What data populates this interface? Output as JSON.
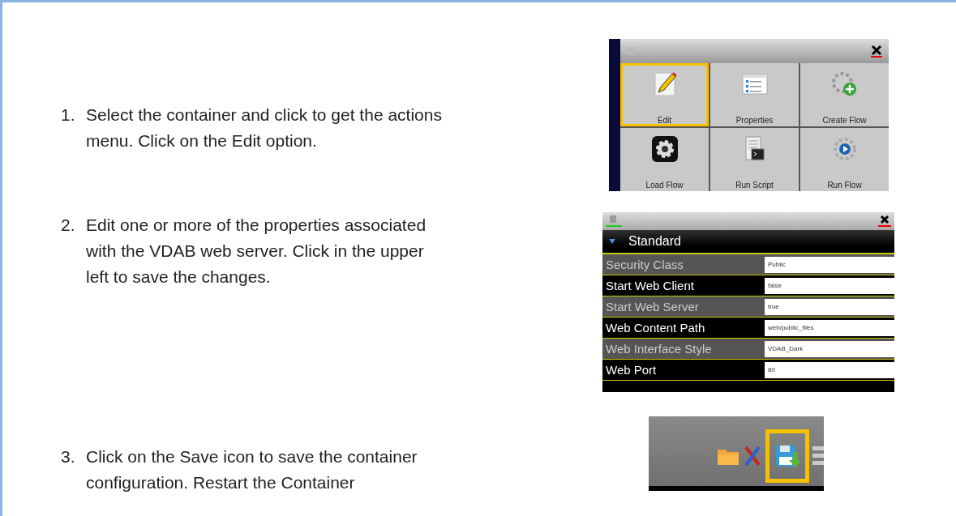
{
  "steps": [
    {
      "number": "1.",
      "text": "Select the container and click to get the actions menu. Click on the Edit option.",
      "screenshot": {
        "kind": "actions_menu",
        "tiles": [
          {
            "label": "Edit",
            "kind": "pencil",
            "selected": true
          },
          {
            "label": "Properties",
            "kind": "properties",
            "selected": false
          },
          {
            "label": "Create Flow",
            "kind": "create",
            "selected": false
          },
          {
            "label": "Load Flow",
            "kind": "load",
            "selected": false
          },
          {
            "label": "Run Script",
            "kind": "script",
            "selected": false
          },
          {
            "label": "Run Flow",
            "kind": "run",
            "selected": false
          }
        ]
      }
    },
    {
      "number": "2.",
      "text": "Edit one or more of the properties associated with the VDAB web server. Click in the upper left to save the changes.",
      "screenshot": {
        "kind": "properties",
        "section": "Standard",
        "rows": [
          {
            "label": "Security Class",
            "value": "Public"
          },
          {
            "label": "Start Web Client",
            "value": "false"
          },
          {
            "label": "Start Web Server",
            "value": "true"
          },
          {
            "label": "Web Content Path",
            "value": "web/public_files"
          },
          {
            "label": "Web Interface Style",
            "value": "VDAB_Dark"
          },
          {
            "label": "Web Port",
            "value": "80"
          }
        ]
      }
    },
    {
      "number": "3.",
      "text": "Click on the Save icon to save the container configuration. Restart the Container",
      "screenshot": {
        "kind": "toolbar",
        "icons": [
          {
            "kind": "folder",
            "highlighted": false
          },
          {
            "kind": "tools",
            "highlighted": false
          },
          {
            "kind": "save",
            "highlighted": true
          },
          {
            "kind": "list",
            "highlighted": false
          }
        ]
      }
    }
  ]
}
